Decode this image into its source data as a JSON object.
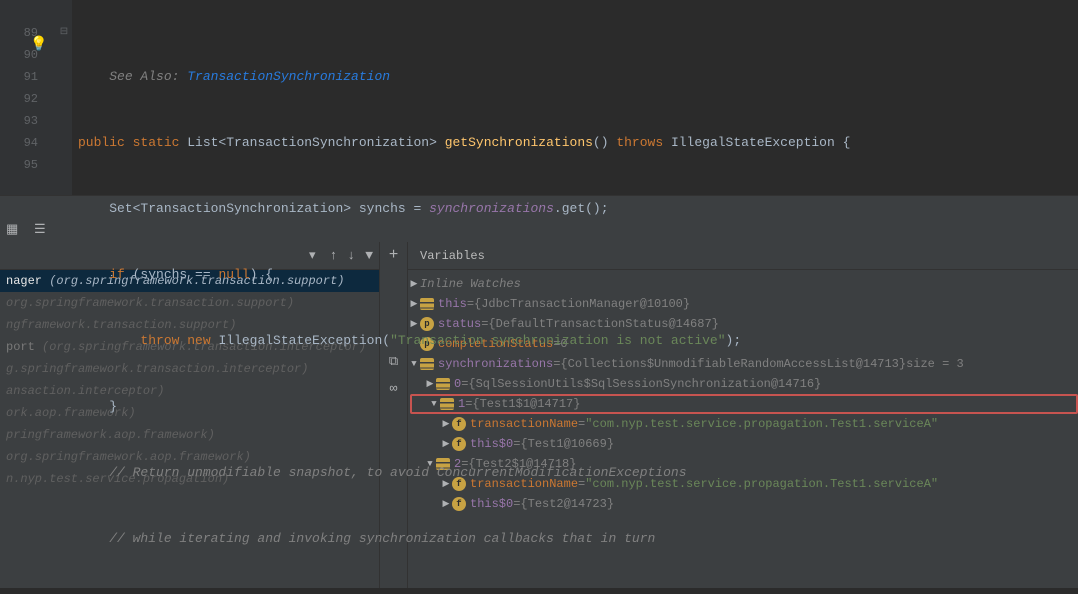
{
  "editor": {
    "seeAlso": "See Also: ",
    "seeAlsoLink": "TransactionSynchronization",
    "line89": {
      "public": "public ",
      "static": "static ",
      "listOpen": "List<",
      "generic": "TransactionSynchronization",
      "listClose": ">",
      "method": " getSynchronizations",
      "parens": "()",
      "throws": " throws ",
      "exception": "IllegalStateException",
      "brace": " {"
    },
    "line90": {
      "setOpen": "    Set<",
      "generic": "TransactionSynchronization",
      "setClose": "> synchs = ",
      "field": "synchronizations",
      "call": ".get();"
    },
    "line91": {
      "if": "    if ",
      "cond": "(synchs == ",
      "null": "null",
      "rest": ") {"
    },
    "line92": {
      "throw": "        throw new ",
      "ex": "IllegalStateException",
      "open": "(",
      "msg": "\"Transaction synchronization is not active\"",
      "close": ");"
    },
    "line93": "    }",
    "line94": "    // Return unmodifiable snapshot, to avoid ConcurrentModificationExceptions",
    "line95": "    // while iterating and invoking synchronization callbacks that in turn",
    "lineNumbers": [
      "",
      "89",
      "90",
      "91",
      "92",
      "93",
      "94",
      "95"
    ]
  },
  "debug": {
    "variablesHeader": "Variables",
    "inlineWatches": "Inline Watches",
    "frames": [
      {
        "text": "nager ",
        "pkg": "(org.springframework.transaction.support)",
        "selected": true
      },
      {
        "text": "",
        "pkg": "org.springframework.transaction.support)"
      },
      {
        "text": "",
        "pkg": "ngframework.transaction.support)"
      },
      {
        "text": "port ",
        "pkg": "(org.springframework.transaction.interceptor)"
      },
      {
        "text": "",
        "pkg": "g.springframework.transaction.interceptor)"
      },
      {
        "text": "",
        "pkg": "ansaction.interceptor)"
      },
      {
        "text": "",
        "pkg": "ork.aop.framework)"
      },
      {
        "text": "",
        "pkg": "pringframework.aop.framework)"
      },
      {
        "text": "",
        "pkg": "org.springframework.aop.framework)"
      },
      {
        "text": "",
        "pkg": "n.nyp.test.service.propagation)"
      }
    ],
    "watchIcons": {
      "add": "+",
      "copy": "⧉",
      "eval": "⊞",
      "link": "∞"
    },
    "tree": {
      "this": {
        "name": "this",
        "val": "{JdbcTransactionManager@10100}"
      },
      "status": {
        "name": "status",
        "val": "{DefaultTransactionStatus@14687}"
      },
      "completionStatus": {
        "name": "completionStatus",
        "val": "0"
      },
      "synchronizations": {
        "name": "synchronizations",
        "val": "{Collections$UnmodifiableRandomAccessList@14713}",
        "size": "  size = 3"
      },
      "item0": {
        "name": "0",
        "val": "{SqlSessionUtils$SqlSessionSynchronization@14716}"
      },
      "item1": {
        "name": "1",
        "val": "{Test1$1@14717}"
      },
      "tn1": {
        "name": "transactionName",
        "val": "\"com.nyp.test.service.propagation.Test1.serviceA\""
      },
      "t0_1": {
        "name": "this$0",
        "val": "{Test1@10669}"
      },
      "item2": {
        "name": "2",
        "val": "{Test2$1@14718}"
      },
      "tn2": {
        "name": "transactionName",
        "val": "\"com.nyp.test.service.propagation.Test1.serviceA\""
      },
      "t0_2": {
        "name": "this$0",
        "val": "{Test2@14723}"
      }
    }
  },
  "tbicons": {
    "dropdown": "▾",
    "up": "↑",
    "down": "↓",
    "filter": "⏷"
  },
  "eq": " = "
}
